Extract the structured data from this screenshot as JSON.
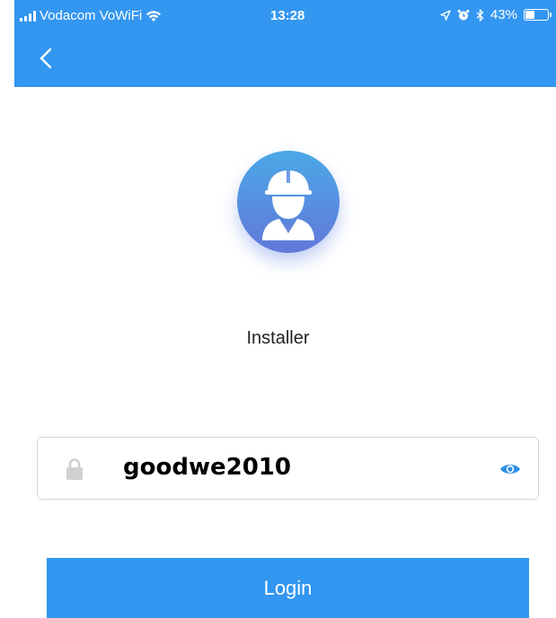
{
  "status_bar": {
    "carrier": "Vodacom VoWiFi",
    "time": "13:28",
    "battery_percent": "43%",
    "battery_level": 0.43,
    "icons": [
      "signal-icon",
      "wifi-icon",
      "location-arrow-icon",
      "alarm-icon",
      "bluetooth-icon",
      "battery-icon"
    ]
  },
  "header": {
    "back_icon": "chevron-left-icon",
    "background_color": "#3396f0"
  },
  "role": {
    "avatar_icon": "installer-hardhat-avatar-icon",
    "label": "Installer"
  },
  "password_field": {
    "value": "goodwe2010",
    "lock_icon": "lock-icon",
    "visibility_icon": "eye-icon"
  },
  "login": {
    "label": "Login",
    "color": "#3396f0"
  }
}
